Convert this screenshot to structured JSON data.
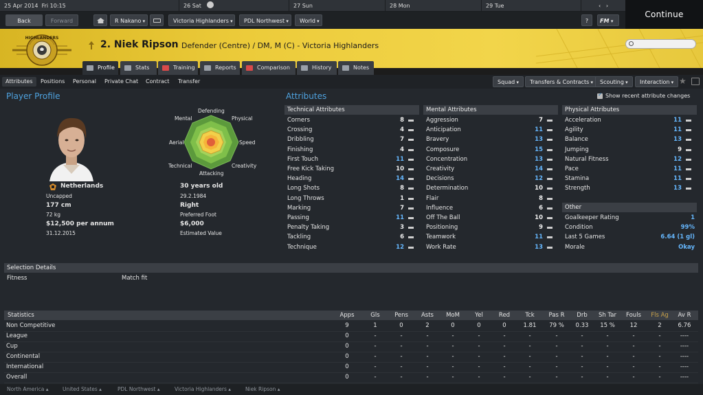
{
  "datebar": {
    "current": "25 Apr 2014",
    "day": "Fri 10:15",
    "d1": "26 Sat",
    "d2": "27 Sun",
    "d3": "28 Mon",
    "d4": "29 Tue"
  },
  "continue_label": "Continue",
  "nav": {
    "back": "Back",
    "forward": "Forward",
    "manager": "R Nakano",
    "club": "Victoria Highlanders",
    "league": "PDL Northwest",
    "world": "World",
    "help": "?",
    "fm": "FM"
  },
  "player": {
    "name": "2. Niek Ripson",
    "desc": "Defender (Centre) / DM, M (C) - Victoria Highlanders"
  },
  "ptabs": [
    "Profile",
    "Stats",
    "Training",
    "Reports",
    "Comparison",
    "History",
    "Notes"
  ],
  "subtabs": [
    "Attributes",
    "Positions",
    "Personal",
    "Private Chat",
    "Contract",
    "Transfer"
  ],
  "subbuttons": [
    "Squad",
    "Transfers & Contracts",
    "Scouting",
    "Interaction"
  ],
  "profile": {
    "header": "Player Profile",
    "nation": "Netherlands",
    "caps": "Uncapped",
    "height": "177 cm",
    "weight": "72 kg",
    "wage": "$12,500 per annum",
    "contract": "31.12.2015",
    "age": "30 years old",
    "dob": "29.2.1984",
    "foot": "Right",
    "foot_label": "Preferred Foot",
    "value": "$6,000",
    "value_label": "Estimated Value"
  },
  "radar": {
    "labels": [
      "Defending",
      "Physical",
      "Speed",
      "Creativity",
      "Attacking",
      "Technical",
      "Aerial",
      "Mental"
    ]
  },
  "attributes": {
    "header": "Attributes",
    "show_recent": "Show recent attribute changes",
    "technical_title": "Technical Attributes",
    "technical": [
      [
        "Corners",
        "8"
      ],
      [
        "Crossing",
        "4"
      ],
      [
        "Dribbling",
        "7"
      ],
      [
        "Finishing",
        "4"
      ],
      [
        "First Touch",
        "11"
      ],
      [
        "Free Kick Taking",
        "10"
      ],
      [
        "Heading",
        "14"
      ],
      [
        "Long Shots",
        "8"
      ],
      [
        "Long Throws",
        "1"
      ],
      [
        "Marking",
        "7"
      ],
      [
        "Passing",
        "11"
      ],
      [
        "Penalty Taking",
        "3"
      ],
      [
        "Tackling",
        "6"
      ],
      [
        "Technique",
        "12"
      ]
    ],
    "mental_title": "Mental Attributes",
    "mental": [
      [
        "Aggression",
        "7"
      ],
      [
        "Anticipation",
        "11"
      ],
      [
        "Bravery",
        "13"
      ],
      [
        "Composure",
        "15"
      ],
      [
        "Concentration",
        "13"
      ],
      [
        "Creativity",
        "14"
      ],
      [
        "Decisions",
        "12"
      ],
      [
        "Determination",
        "10"
      ],
      [
        "Flair",
        "8"
      ],
      [
        "Influence",
        "6"
      ],
      [
        "Off The Ball",
        "10"
      ],
      [
        "Positioning",
        "9"
      ],
      [
        "Teamwork",
        "11"
      ],
      [
        "Work Rate",
        "13"
      ]
    ],
    "physical_title": "Physical Attributes",
    "physical": [
      [
        "Acceleration",
        "11"
      ],
      [
        "Agility",
        "11"
      ],
      [
        "Balance",
        "13"
      ],
      [
        "Jumping",
        "9"
      ],
      [
        "Natural Fitness",
        "12"
      ],
      [
        "Pace",
        "11"
      ],
      [
        "Stamina",
        "11"
      ],
      [
        "Strength",
        "13"
      ]
    ],
    "other_title": "Other",
    "other": [
      [
        "Goalkeeper Rating",
        "1"
      ],
      [
        "Condition",
        "99%"
      ],
      [
        "Last 5 Games",
        "6.64 (1 gl)"
      ],
      [
        "Morale",
        "Okay"
      ]
    ]
  },
  "selection": {
    "title": "Selection Details",
    "fitness_label": "Fitness",
    "fitness_value": "Match fit"
  },
  "stats": {
    "title": "Statistics",
    "cols": [
      "Apps",
      "Gls",
      "Pens",
      "Asts",
      "MoM",
      "Yel",
      "Red",
      "Tck",
      "Pas R",
      "Drb",
      "Sh Tar",
      "Fouls",
      "Fls Ag",
      "Av R"
    ],
    "rows": [
      [
        "Non Competitive",
        "9",
        "1",
        "0",
        "2",
        "0",
        "0",
        "0",
        "1.81",
        "79 %",
        "0.33",
        "15 %",
        "12",
        "2",
        "6.76"
      ],
      [
        "League",
        "0",
        "-",
        "-",
        "-",
        "-",
        "-",
        "-",
        "-",
        "-",
        "-",
        "-",
        "-",
        "-",
        "----"
      ],
      [
        "Cup",
        "0",
        "-",
        "-",
        "-",
        "-",
        "-",
        "-",
        "-",
        "-",
        "-",
        "-",
        "-",
        "-",
        "----"
      ],
      [
        "Continental",
        "0",
        "-",
        "-",
        "-",
        "-",
        "-",
        "-",
        "-",
        "-",
        "-",
        "-",
        "-",
        "-",
        "----"
      ],
      [
        "International",
        "0",
        "-",
        "-",
        "-",
        "-",
        "-",
        "-",
        "-",
        "-",
        "-",
        "-",
        "-",
        "-",
        "----"
      ],
      [
        "Overall",
        "0",
        "-",
        "-",
        "-",
        "-",
        "-",
        "-",
        "-",
        "-",
        "-",
        "-",
        "-",
        "-",
        "----"
      ]
    ]
  },
  "footer": [
    "North America",
    "United States",
    "PDL Northwest",
    "Victoria Highlanders",
    "Niek Ripson"
  ],
  "crest_text": "HIGHLANDERS"
}
